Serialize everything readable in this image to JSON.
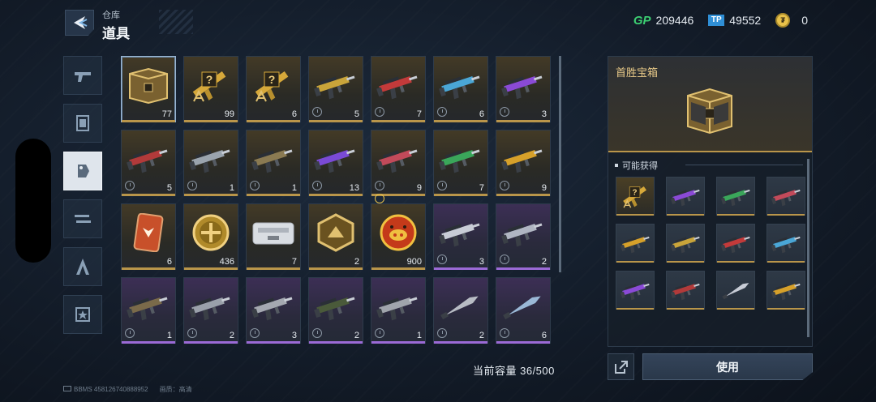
{
  "header": {
    "subtitle": "仓库",
    "title": "道具"
  },
  "currencies": [
    {
      "icon": "gp-icon",
      "label": "GP",
      "value": "209446"
    },
    {
      "icon": "tp-icon",
      "label": "TP",
      "value": "49552"
    },
    {
      "icon": "coin-icon",
      "value": "0"
    }
  ],
  "categories": [
    {
      "name": "weapons",
      "icon": "pistol-icon",
      "active": false
    },
    {
      "name": "character",
      "icon": "card-frame-icon",
      "active": false
    },
    {
      "name": "items",
      "icon": "tag-icon",
      "active": true
    },
    {
      "name": "decor",
      "icon": "gun-swap-icon",
      "active": false
    },
    {
      "name": "badge",
      "icon": "rank-a-icon",
      "active": false
    },
    {
      "name": "emblem",
      "icon": "star-badge-icon",
      "active": false
    }
  ],
  "inventory": [
    {
      "type": "chest",
      "rarity": "gold",
      "qty": "77",
      "selected": true
    },
    {
      "type": "mystery-gun",
      "rarity": "gold",
      "qty": "99"
    },
    {
      "type": "mystery-gun",
      "rarity": "gold",
      "qty": "6"
    },
    {
      "type": "gun",
      "rarity": "gold",
      "qty": "5",
      "color": "#c9a43a"
    },
    {
      "type": "gun",
      "rarity": "gold",
      "qty": "7",
      "color": "#c23a3a"
    },
    {
      "type": "gun",
      "rarity": "gold",
      "qty": "6",
      "color": "#4aa6d6"
    },
    {
      "type": "gun",
      "rarity": "gold",
      "qty": "3",
      "color": "#8a4ad6"
    },
    {
      "type": "gun",
      "rarity": "gold",
      "qty": "5",
      "color": "#b23a3a"
    },
    {
      "type": "gun",
      "rarity": "gold",
      "qty": "1",
      "color": "#9aa4ae"
    },
    {
      "type": "gun",
      "rarity": "gold",
      "qty": "1",
      "color": "#8a7a52"
    },
    {
      "type": "gun",
      "rarity": "gold",
      "qty": "13",
      "color": "#7a4ad6"
    },
    {
      "type": "gun",
      "rarity": "gold",
      "qty": "9",
      "color": "#c24a5a"
    },
    {
      "type": "gun",
      "rarity": "gold",
      "qty": "7",
      "color": "#3aa65a"
    },
    {
      "type": "gun",
      "rarity": "gold",
      "qty": "9",
      "color": "#d6a02a"
    },
    {
      "type": "card",
      "rarity": "gold",
      "qty": "6"
    },
    {
      "type": "coin",
      "rarity": "gold",
      "qty": "436"
    },
    {
      "type": "case",
      "rarity": "gold",
      "qty": "7"
    },
    {
      "type": "hex-badge",
      "rarity": "gold",
      "qty": "2"
    },
    {
      "type": "pig-coin",
      "rarity": "gold",
      "qty": "900",
      "timer": true
    },
    {
      "type": "gun",
      "rarity": "purple",
      "qty": "3",
      "color": "#c8ccd6"
    },
    {
      "type": "gun",
      "rarity": "purple",
      "qty": "2",
      "color": "#b0b6c2"
    },
    {
      "type": "gun",
      "rarity": "purple",
      "qty": "1",
      "color": "#7a6a4a"
    },
    {
      "type": "gun",
      "rarity": "purple",
      "qty": "2",
      "color": "#9aa0aa"
    },
    {
      "type": "gun",
      "rarity": "purple",
      "qty": "3",
      "color": "#a4a8b0"
    },
    {
      "type": "gun",
      "rarity": "purple",
      "qty": "2",
      "color": "#4a5a3a"
    },
    {
      "type": "gun",
      "rarity": "purple",
      "qty": "1",
      "color": "#a0a4ac"
    },
    {
      "type": "blade",
      "rarity": "purple",
      "qty": "2",
      "color": "#b8bcc4"
    },
    {
      "type": "blade",
      "rarity": "purple",
      "qty": "6",
      "color": "#9ab8d6"
    }
  ],
  "capacity_label": "当前容量 36/500",
  "detail": {
    "name": "首胜宝箱",
    "rewards_header": "可能获得",
    "rewards": [
      {
        "type": "mystery-gun",
        "color": "#c9a43a",
        "rarity": "gold"
      },
      {
        "type": "gun",
        "color": "#8a4ad6"
      },
      {
        "type": "gun",
        "color": "#3aa65a"
      },
      {
        "type": "gun",
        "color": "#c24a5a"
      },
      {
        "type": "gun",
        "color": "#d6a02a"
      },
      {
        "type": "gun",
        "color": "#c9a43a"
      },
      {
        "type": "gun",
        "color": "#c23a3a"
      },
      {
        "type": "gun",
        "color": "#4aa6d6"
      },
      {
        "type": "gun",
        "color": "#8a4ad6"
      },
      {
        "type": "gun",
        "color": "#b23a3a"
      },
      {
        "type": "blade",
        "color": "#c8ccd6"
      },
      {
        "type": "gun",
        "color": "#d6a02a"
      }
    ],
    "use_label": "使用"
  },
  "footer": {
    "id_text": "BBMS  458126740888952",
    "quality_text": "画质：高清"
  }
}
